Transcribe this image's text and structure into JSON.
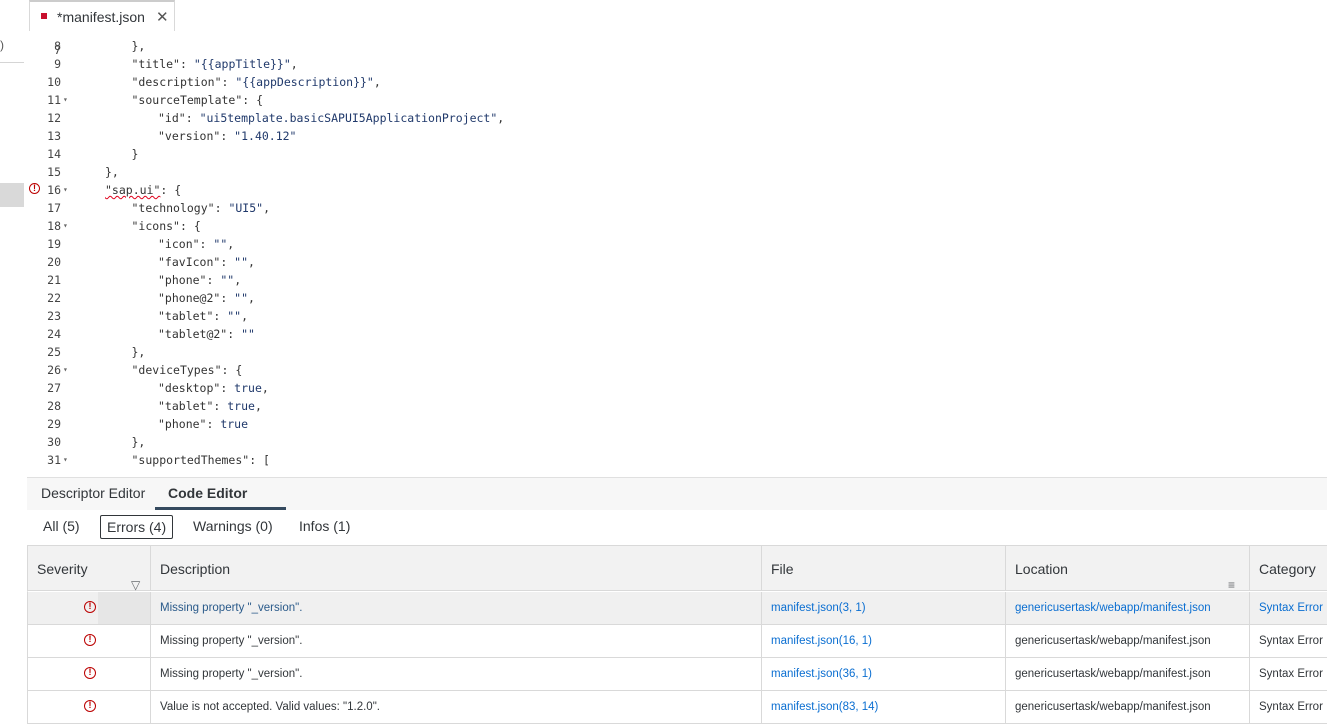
{
  "left_panel": {
    "glyph": ")"
  },
  "tab": {
    "dirty_marker": "*",
    "title": "manifest.json",
    "close": "✕"
  },
  "code_lines": [
    {
      "ln": "8",
      "fold": false,
      "indent": 3,
      "parts": [
        [
          "p",
          "},"
        ]
      ]
    },
    {
      "ln": "9",
      "fold": false,
      "indent": 3,
      "parts": [
        [
          "k",
          "\"title\""
        ],
        [
          "p",
          ": "
        ],
        [
          "s",
          "\"{{appTitle}}\""
        ],
        [
          "p",
          ","
        ]
      ]
    },
    {
      "ln": "10",
      "fold": false,
      "indent": 3,
      "parts": [
        [
          "k",
          "\"description\""
        ],
        [
          "p",
          ": "
        ],
        [
          "s",
          "\"{{appDescription}}\""
        ],
        [
          "p",
          ","
        ]
      ]
    },
    {
      "ln": "11",
      "fold": true,
      "indent": 3,
      "parts": [
        [
          "k",
          "\"sourceTemplate\""
        ],
        [
          "p",
          ": {"
        ]
      ]
    },
    {
      "ln": "12",
      "fold": false,
      "indent": 4,
      "parts": [
        [
          "k",
          "\"id\""
        ],
        [
          "p",
          ": "
        ],
        [
          "s",
          "\"ui5template.basicSAPUI5ApplicationProject\""
        ],
        [
          "p",
          ","
        ]
      ]
    },
    {
      "ln": "13",
      "fold": false,
      "indent": 4,
      "parts": [
        [
          "k",
          "\"version\""
        ],
        [
          "p",
          ": "
        ],
        [
          "s",
          "\"1.40.12\""
        ]
      ]
    },
    {
      "ln": "14",
      "fold": false,
      "indent": 3,
      "parts": [
        [
          "p",
          "}"
        ]
      ]
    },
    {
      "ln": "15",
      "fold": false,
      "indent": 2,
      "parts": [
        [
          "p",
          "},"
        ]
      ]
    },
    {
      "ln": "16",
      "fold": true,
      "indent": 2,
      "error": true,
      "parts": [
        [
          "e",
          "\"sap.ui\""
        ],
        [
          "p",
          ": {"
        ]
      ]
    },
    {
      "ln": "17",
      "fold": false,
      "indent": 3,
      "parts": [
        [
          "k",
          "\"technology\""
        ],
        [
          "p",
          ": "
        ],
        [
          "s",
          "\"UI5\""
        ],
        [
          "p",
          ","
        ]
      ]
    },
    {
      "ln": "18",
      "fold": true,
      "indent": 3,
      "parts": [
        [
          "k",
          "\"icons\""
        ],
        [
          "p",
          ": {"
        ]
      ]
    },
    {
      "ln": "19",
      "fold": false,
      "indent": 4,
      "parts": [
        [
          "k",
          "\"icon\""
        ],
        [
          "p",
          ": "
        ],
        [
          "s",
          "\"\""
        ],
        [
          "p",
          ","
        ]
      ]
    },
    {
      "ln": "20",
      "fold": false,
      "indent": 4,
      "parts": [
        [
          "k",
          "\"favIcon\""
        ],
        [
          "p",
          ": "
        ],
        [
          "s",
          "\"\""
        ],
        [
          "p",
          ","
        ]
      ]
    },
    {
      "ln": "21",
      "fold": false,
      "indent": 4,
      "parts": [
        [
          "k",
          "\"phone\""
        ],
        [
          "p",
          ": "
        ],
        [
          "s",
          "\"\""
        ],
        [
          "p",
          ","
        ]
      ]
    },
    {
      "ln": "22",
      "fold": false,
      "indent": 4,
      "parts": [
        [
          "k",
          "\"phone@2\""
        ],
        [
          "p",
          ": "
        ],
        [
          "s",
          "\"\""
        ],
        [
          "p",
          ","
        ]
      ]
    },
    {
      "ln": "23",
      "fold": false,
      "indent": 4,
      "parts": [
        [
          "k",
          "\"tablet\""
        ],
        [
          "p",
          ": "
        ],
        [
          "s",
          "\"\""
        ],
        [
          "p",
          ","
        ]
      ]
    },
    {
      "ln": "24",
      "fold": false,
      "indent": 4,
      "parts": [
        [
          "k",
          "\"tablet@2\""
        ],
        [
          "p",
          ": "
        ],
        [
          "s",
          "\"\""
        ]
      ]
    },
    {
      "ln": "25",
      "fold": false,
      "indent": 3,
      "parts": [
        [
          "p",
          "},"
        ]
      ]
    },
    {
      "ln": "26",
      "fold": true,
      "indent": 3,
      "parts": [
        [
          "k",
          "\"deviceTypes\""
        ],
        [
          "p",
          ": {"
        ]
      ]
    },
    {
      "ln": "27",
      "fold": false,
      "indent": 4,
      "parts": [
        [
          "k",
          "\"desktop\""
        ],
        [
          "p",
          ": "
        ],
        [
          "s",
          "true"
        ],
        [
          "p",
          ","
        ]
      ]
    },
    {
      "ln": "28",
      "fold": false,
      "indent": 4,
      "parts": [
        [
          "k",
          "\"tablet\""
        ],
        [
          "p",
          ": "
        ],
        [
          "s",
          "true"
        ],
        [
          "p",
          ","
        ]
      ]
    },
    {
      "ln": "29",
      "fold": false,
      "indent": 4,
      "parts": [
        [
          "k",
          "\"phone\""
        ],
        [
          "p",
          ": "
        ],
        [
          "s",
          "true"
        ]
      ]
    },
    {
      "ln": "30",
      "fold": false,
      "indent": 3,
      "parts": [
        [
          "p",
          "},"
        ]
      ]
    },
    {
      "ln": "31",
      "fold": true,
      "indent": 3,
      "parts": [
        [
          "k",
          "\"supportedThemes\""
        ],
        [
          "p",
          ": ["
        ]
      ]
    }
  ],
  "editor_tabs": {
    "descriptor": "Descriptor Editor",
    "code": "Code Editor"
  },
  "filters": {
    "all": "All (5)",
    "errors": "Errors (4)",
    "warnings": "Warnings (0)",
    "infos": "Infos (1)"
  },
  "table": {
    "headers": {
      "severity": "Severity",
      "description": "Description",
      "file": "File",
      "location": "Location",
      "category": "Category"
    },
    "rows": [
      {
        "description": "Missing property \"_version\".",
        "file": "manifest.json(3, 1)",
        "location": "genericusertask/webapp/manifest.json",
        "category": "Syntax Error"
      },
      {
        "description": "Missing property \"_version\".",
        "file": "manifest.json(16, 1)",
        "location": "genericusertask/webapp/manifest.json",
        "category": "Syntax Error"
      },
      {
        "description": "Missing property \"_version\".",
        "file": "manifest.json(36, 1)",
        "location": "genericusertask/webapp/manifest.json",
        "category": "Syntax Error"
      },
      {
        "description": "Value is not accepted. Valid values: \"1.2.0\".",
        "file": "manifest.json(83, 14)",
        "location": "genericusertask/webapp/manifest.json",
        "category": "Syntax Error"
      }
    ]
  }
}
